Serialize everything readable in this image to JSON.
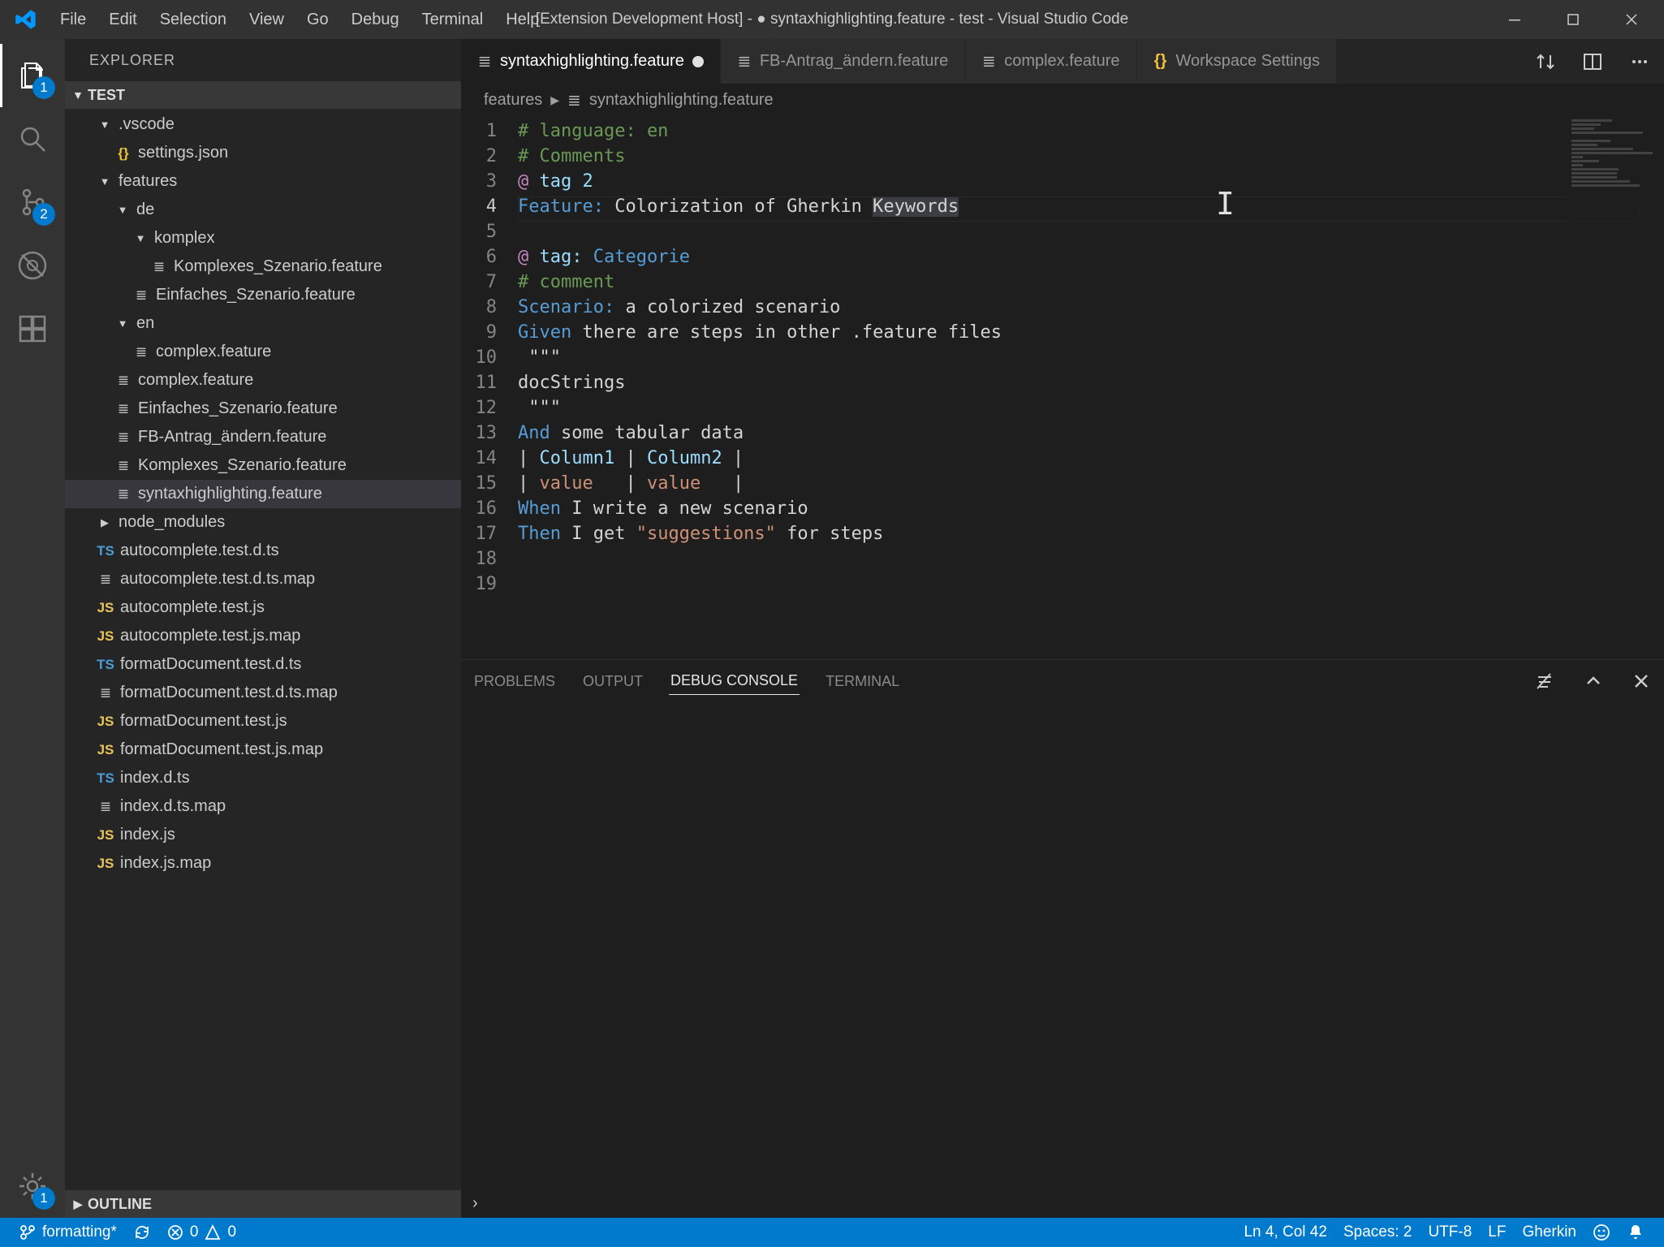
{
  "title": "[Extension Development Host] - ● syntaxhighlighting.feature - test - Visual Studio Code",
  "menus": [
    "File",
    "Edit",
    "Selection",
    "View",
    "Go",
    "Debug",
    "Terminal",
    "Help"
  ],
  "activity": {
    "files_badge": "1",
    "scm_badge": "2",
    "gear_badge": "1"
  },
  "explorer": {
    "title": "EXPLORER",
    "section": "TEST",
    "outline": "OUTLINE",
    "tree": [
      {
        "t": "folder",
        "d": 1,
        "open": true,
        "name": ".vscode"
      },
      {
        "t": "file",
        "d": 2,
        "ico": "json",
        "name": "settings.json"
      },
      {
        "t": "folder",
        "d": 1,
        "open": true,
        "name": "features"
      },
      {
        "t": "folder",
        "d": 2,
        "open": true,
        "name": "de"
      },
      {
        "t": "folder",
        "d": 3,
        "open": true,
        "name": "komplex"
      },
      {
        "t": "file",
        "d": 4,
        "ico": "feat",
        "name": "Komplexes_Szenario.feature"
      },
      {
        "t": "file",
        "d": 3,
        "ico": "feat",
        "name": "Einfaches_Szenario.feature"
      },
      {
        "t": "folder",
        "d": 2,
        "open": true,
        "name": "en"
      },
      {
        "t": "file",
        "d": 3,
        "ico": "feat",
        "name": "complex.feature"
      },
      {
        "t": "file",
        "d": 2,
        "ico": "feat",
        "name": "complex.feature"
      },
      {
        "t": "file",
        "d": 2,
        "ico": "feat",
        "name": "Einfaches_Szenario.feature"
      },
      {
        "t": "file",
        "d": 2,
        "ico": "feat",
        "name": "FB-Antrag_ändern.feature"
      },
      {
        "t": "file",
        "d": 2,
        "ico": "feat",
        "name": "Komplexes_Szenario.feature"
      },
      {
        "t": "file",
        "d": 2,
        "ico": "feat",
        "name": "syntaxhighlighting.feature",
        "selected": true
      },
      {
        "t": "folder",
        "d": 1,
        "open": false,
        "name": "node_modules"
      },
      {
        "t": "file",
        "d": 1,
        "ico": "ts",
        "name": "autocomplete.test.d.ts"
      },
      {
        "t": "file",
        "d": 1,
        "ico": "map",
        "name": "autocomplete.test.d.ts.map"
      },
      {
        "t": "file",
        "d": 1,
        "ico": "js",
        "name": "autocomplete.test.js"
      },
      {
        "t": "file",
        "d": 1,
        "ico": "js",
        "name": "autocomplete.test.js.map"
      },
      {
        "t": "file",
        "d": 1,
        "ico": "ts",
        "name": "formatDocument.test.d.ts"
      },
      {
        "t": "file",
        "d": 1,
        "ico": "map",
        "name": "formatDocument.test.d.ts.map"
      },
      {
        "t": "file",
        "d": 1,
        "ico": "js",
        "name": "formatDocument.test.js"
      },
      {
        "t": "file",
        "d": 1,
        "ico": "js",
        "name": "formatDocument.test.js.map"
      },
      {
        "t": "file",
        "d": 1,
        "ico": "ts",
        "name": "index.d.ts"
      },
      {
        "t": "file",
        "d": 1,
        "ico": "map",
        "name": "index.d.ts.map"
      },
      {
        "t": "file",
        "d": 1,
        "ico": "js",
        "name": "index.js"
      },
      {
        "t": "file",
        "d": 1,
        "ico": "js",
        "name": "index.js.map"
      }
    ]
  },
  "tabs": [
    {
      "label": "syntaxhighlighting.feature",
      "icon": "feat",
      "active": true,
      "dirty": true
    },
    {
      "label": "FB-Antrag_ändern.feature",
      "icon": "feat"
    },
    {
      "label": "complex.feature",
      "icon": "feat"
    },
    {
      "label": "Workspace Settings",
      "icon": "json"
    }
  ],
  "breadcrumbs": {
    "folder": "features",
    "file": "syntaxhighlighting.feature"
  },
  "code": {
    "lines": [
      [
        {
          "c": "comment",
          "t": "# language: en"
        }
      ],
      [
        {
          "c": "comment",
          "t": "# Comments"
        }
      ],
      [
        {
          "c": "tag",
          "t": "@"
        },
        {
          "c": "tagval",
          "t": " tag 2"
        }
      ],
      [
        {
          "c": "feature",
          "t": "Feature:"
        },
        {
          "c": "text",
          "t": " Colorization of Gherkin "
        },
        {
          "c": "text sel",
          "t": "Keywords"
        }
      ],
      [
        {
          "c": "text",
          "t": ""
        }
      ],
      [
        {
          "c": "tag",
          "t": "@"
        },
        {
          "c": "tagval",
          "t": " tag:"
        },
        {
          "c": "feature",
          "t": " Categorie"
        }
      ],
      [
        {
          "c": "comment",
          "t": "# comment"
        }
      ],
      [
        {
          "c": "feature",
          "t": "Scenario:"
        },
        {
          "c": "text",
          "t": " a colorized scenario"
        }
      ],
      [
        {
          "c": "step",
          "t": "Given"
        },
        {
          "c": "text",
          "t": " there are steps in other .feature files"
        }
      ],
      [
        {
          "c": "text",
          "t": " \"\"\""
        }
      ],
      [
        {
          "c": "text",
          "t": "docStrings"
        }
      ],
      [
        {
          "c": "text",
          "t": " \"\"\""
        }
      ],
      [
        {
          "c": "step",
          "t": "And"
        },
        {
          "c": "text",
          "t": " some tabular data"
        }
      ],
      [
        {
          "c": "pipe",
          "t": "| "
        },
        {
          "c": "tblh",
          "t": "Column1"
        },
        {
          "c": "pipe",
          "t": " | "
        },
        {
          "c": "tblh",
          "t": "Column2"
        },
        {
          "c": "pipe",
          "t": " |"
        }
      ],
      [
        {
          "c": "pipe",
          "t": "| "
        },
        {
          "c": "tblv",
          "t": "value"
        },
        {
          "c": "pipe",
          "t": "   | "
        },
        {
          "c": "tblv",
          "t": "value"
        },
        {
          "c": "pipe",
          "t": "   |"
        }
      ],
      [
        {
          "c": "step",
          "t": "When"
        },
        {
          "c": "text",
          "t": " I write a new scenario"
        }
      ],
      [
        {
          "c": "step",
          "t": "Then"
        },
        {
          "c": "text",
          "t": " I get "
        },
        {
          "c": "string",
          "t": "\"suggestions\""
        },
        {
          "c": "text",
          "t": " for steps"
        }
      ],
      [
        {
          "c": "text",
          "t": ""
        }
      ],
      [
        {
          "c": "text",
          "t": ""
        }
      ]
    ],
    "current_line": 4
  },
  "panel": {
    "tabs": [
      "PROBLEMS",
      "OUTPUT",
      "DEBUG CONSOLE",
      "TERMINAL"
    ],
    "active": 2
  },
  "status": {
    "branch": "formatting*",
    "errors": "0",
    "warnings": "0",
    "position": "Ln 4, Col 42",
    "spaces": "Spaces: 2",
    "encoding": "UTF-8",
    "eol": "LF",
    "lang": "Gherkin"
  }
}
